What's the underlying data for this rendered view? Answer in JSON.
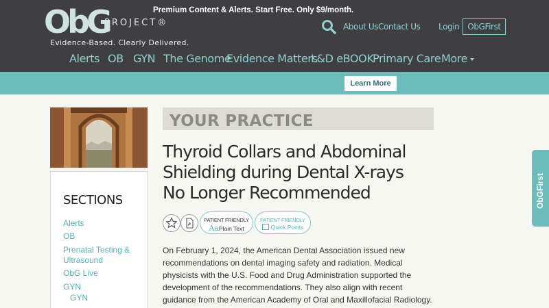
{
  "header": {
    "logo_mark": "ObG",
    "logo_word": "PROJECT®",
    "tagline": "Evidence-Based. Clearly Delivered.",
    "top_links": [
      "About Us",
      "Contact Us",
      "Login"
    ],
    "cta": "ObGFirst"
  },
  "nav": {
    "items": [
      "Alerts",
      "OB",
      "GYN",
      "The Genome",
      "Evidence Matters",
      "L&D eBOOK",
      "Primary Care",
      "More"
    ]
  },
  "banner": {
    "text": "Premium Content & Alerts. Start Free. Only $9/month.",
    "button": "Learn More"
  },
  "sidebar": {
    "title": "SECTIONS",
    "links": [
      "Alerts",
      "OB",
      "Prenatal Testing &",
      "Ultrasound",
      "ObG Live",
      "GYN",
      "GYN"
    ]
  },
  "article": {
    "section": "YOUR PRACTICE",
    "title_lines": [
      "Thyroid Collars and Abdominal",
      "Shielding during Dental X-rays",
      "No Longer Recommended"
    ],
    "pill1": {
      "top": "PATIENT FRIENDLY",
      "bottom": "Plain Text",
      "glyph": "Aa"
    },
    "pill2": {
      "top": "PATIENT FRIENDLY",
      "bottom": "Quick Points"
    },
    "body": "On February 1, 2024, the American Dental Association issued new recommendations on dental imaging safety and radiation. Medical physicists with the U.S. Food and Drug Administration supported the development of the recommendations. They also align with recent guidance from the American Academy of Oral and Maxillofacial Radiology."
  },
  "side_tab": "ObGFirst",
  "colors": {
    "header_bg": "#3f3f41",
    "teal": "#6cbcbc",
    "link_teal": "#52b3b3",
    "nav_teal": "#8fcfcf"
  }
}
